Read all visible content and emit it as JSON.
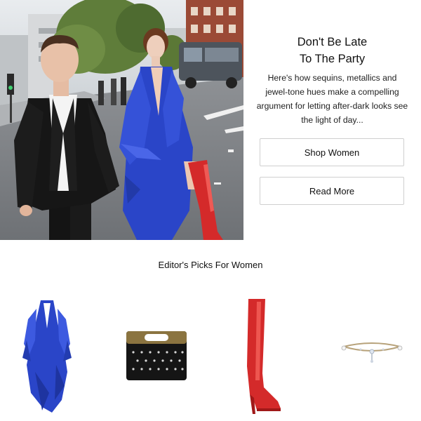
{
  "hero": {
    "image": "fashion-editorial-street-photo",
    "alt_subject": "man-in-black-suit-and-woman-in-blue-dress-with-red-boots"
  },
  "promo": {
    "title_line1": "Don't Be Late",
    "title_line2": "To The Party",
    "body_line1": "Here's how sequins, metallics and",
    "body_line2": "jewel-tone hues make a compelling",
    "body_line3": "argument for letting after-dark looks see",
    "body_line4": "the light of day...",
    "shop_label": "Shop Women",
    "read_label": "Read More"
  },
  "picks": {
    "title": "Editor's Picks For Women",
    "items": [
      {
        "icon": "blue-ruffle-dress-icon"
      },
      {
        "icon": "studded-clutch-bag-icon"
      },
      {
        "icon": "red-thigh-high-boot-icon"
      },
      {
        "icon": "crystal-choker-necklace-icon"
      }
    ]
  },
  "colors": {
    "dress_blue": "#2a45c8",
    "boot_red": "#d42a2a",
    "suit_black": "#151515",
    "button_border": "#cfcfcf"
  }
}
